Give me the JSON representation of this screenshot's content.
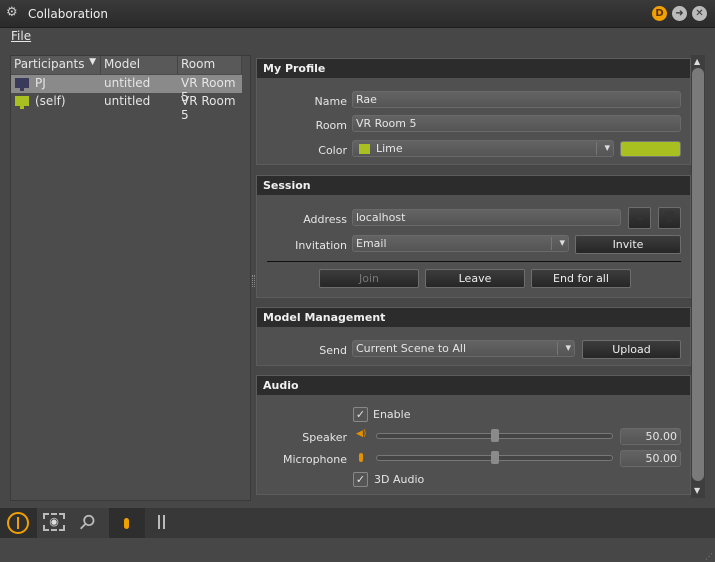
{
  "window": {
    "title": "Collaboration",
    "badge": "D"
  },
  "menu": {
    "file": "File"
  },
  "participants": {
    "columns": [
      "Participants",
      "Model",
      "Room"
    ],
    "rows": [
      {
        "name": "PJ",
        "model": "untitled",
        "room": "VR Room 5",
        "color": "#3a3a5a"
      },
      {
        "name": "(self)",
        "model": "untitled",
        "room": "VR Room 5",
        "color": "#a8c020"
      }
    ]
  },
  "profile": {
    "title": "My Profile",
    "name_label": "Name",
    "name": "Rae",
    "room_label": "Room",
    "room": "VR Room 5",
    "color_label": "Color",
    "color_name": "Lime",
    "color_value": "#a8c020"
  },
  "session": {
    "title": "Session",
    "address_label": "Address",
    "address": "localhost",
    "invitation_label": "Invitation",
    "invitation": "Email",
    "invite": "Invite",
    "join": "Join",
    "leave": "Leave",
    "end_for_all": "End for all"
  },
  "model_management": {
    "title": "Model Management",
    "send_label": "Send",
    "send": "Current Scene to All",
    "upload": "Upload"
  },
  "audio": {
    "title": "Audio",
    "enable": "Enable",
    "speaker_label": "Speaker",
    "speaker": "50.00",
    "speaker_level": 50,
    "microphone_label": "Microphone",
    "microphone": "50.00",
    "microphone_level": 50,
    "audio3d": "3D Audio"
  }
}
